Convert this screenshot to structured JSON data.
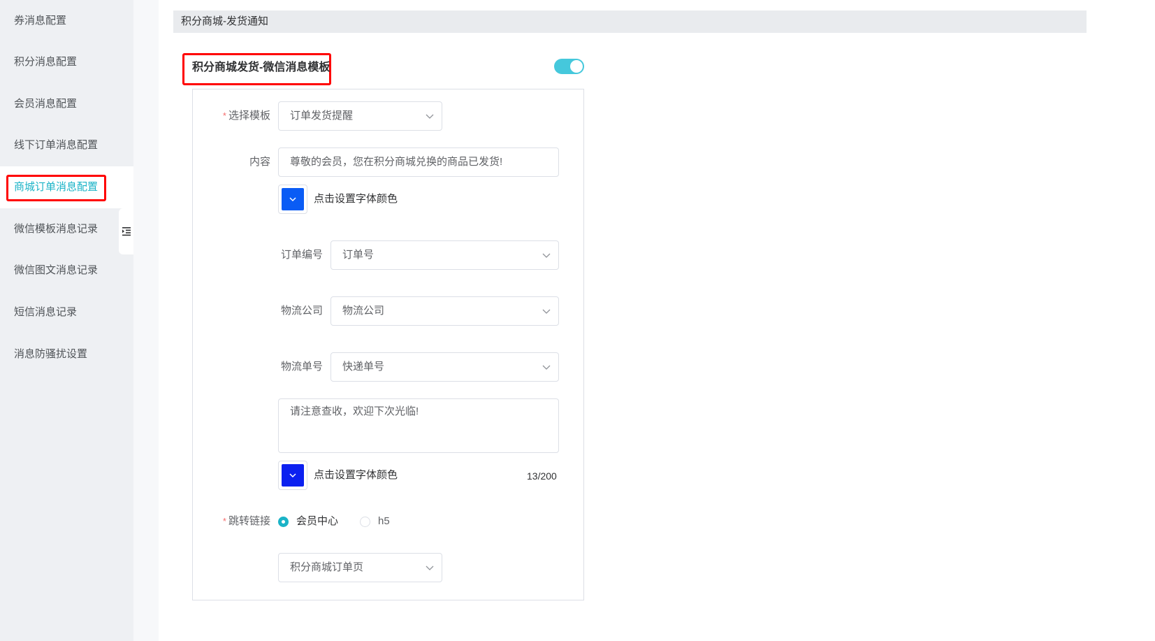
{
  "sidebar": {
    "items": [
      {
        "label": "券消息配置"
      },
      {
        "label": "积分消息配置"
      },
      {
        "label": "会员消息配置"
      },
      {
        "label": "线下订单消息配置"
      },
      {
        "label": "商城订单消息配置",
        "active": true
      },
      {
        "label": "微信模板消息记录"
      },
      {
        "label": "微信图文消息记录"
      },
      {
        "label": "短信消息记录"
      },
      {
        "label": "消息防骚扰设置"
      }
    ],
    "collapse_icon": "indent-icon"
  },
  "section": {
    "title": "积分商城-发货通知"
  },
  "card": {
    "title": "积分商城发货-微信消息模板",
    "enabled": true,
    "template": {
      "label": "选择模板",
      "value": "订单发货提醒"
    },
    "content": {
      "label": "内容",
      "value": "尊敬的会员，您在积分商城兑换的商品已发货!"
    },
    "color_button_label": "点击设置字体颜色",
    "fields": [
      {
        "label": "订单编号",
        "value": "订单号"
      },
      {
        "label": "物流公司",
        "value": "物流公司"
      },
      {
        "label": "物流单号",
        "value": "快递单号"
      }
    ],
    "remark": {
      "value": "请注意查收，欢迎下次光临!",
      "counter": "13/200"
    },
    "jump": {
      "label": "跳转链接",
      "options": [
        {
          "label": "会员中心",
          "selected": true
        },
        {
          "label": "h5",
          "selected": false
        }
      ],
      "page": "积分商城订单页"
    }
  },
  "colors": {
    "accent": "#1ab3c7",
    "switch": "#45c8dc",
    "content_color": "#0a5cf5",
    "remark_color": "#0b20f0",
    "highlight": "#ff0000"
  }
}
